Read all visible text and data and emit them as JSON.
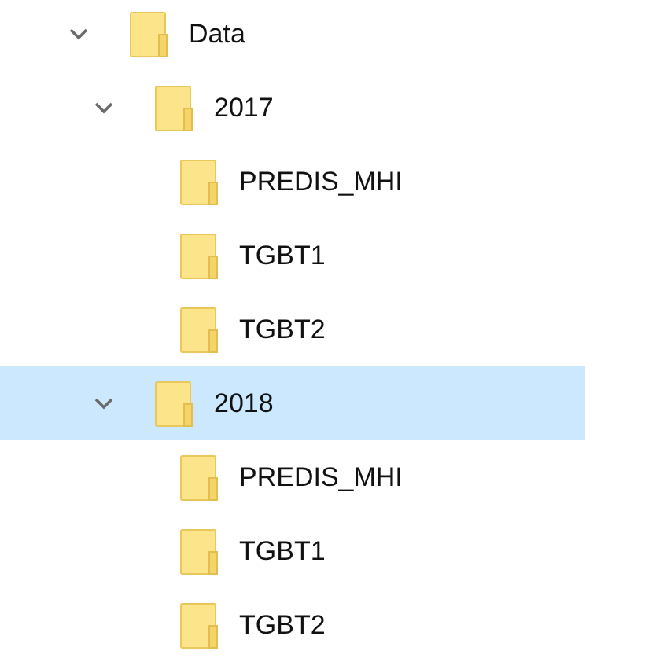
{
  "tree": [
    {
      "label": "Data",
      "expanded": true,
      "selected": false,
      "children": [
        {
          "label": "2017",
          "expanded": true,
          "selected": false,
          "children": [
            {
              "label": "PREDIS_MHI",
              "selected": false
            },
            {
              "label": "TGBT1",
              "selected": false
            },
            {
              "label": "TGBT2",
              "selected": false
            }
          ]
        },
        {
          "label": "2018",
          "expanded": true,
          "selected": true,
          "children": [
            {
              "label": "PREDIS_MHI",
              "selected": false
            },
            {
              "label": "TGBT1",
              "selected": false
            },
            {
              "label": "TGBT2",
              "selected": false
            }
          ]
        }
      ]
    }
  ]
}
